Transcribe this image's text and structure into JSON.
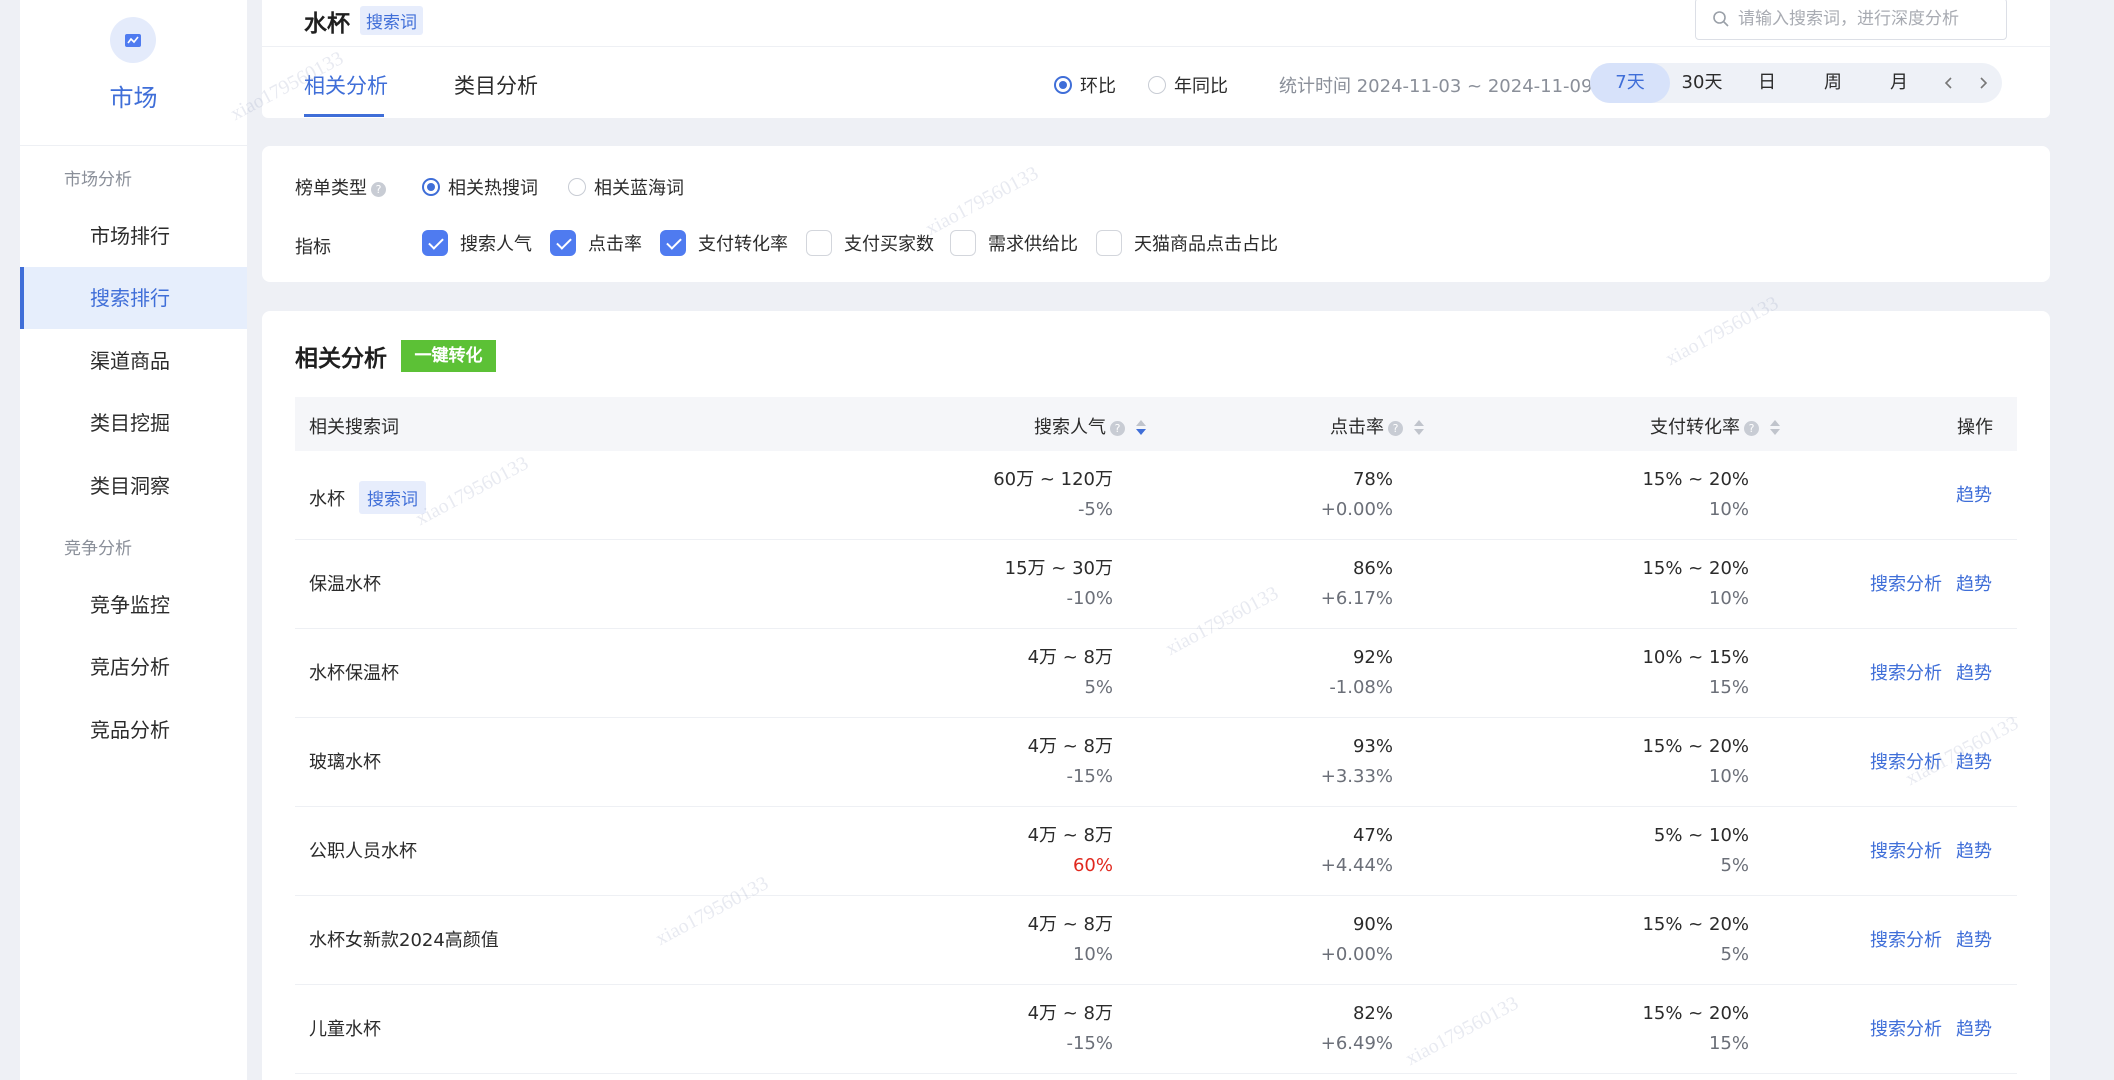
{
  "sidebar": {
    "title": "市场",
    "groups": [
      {
        "label": "市场分析",
        "items": [
          "市场排行",
          "搜索排行",
          "渠道商品",
          "类目挖掘",
          "类目洞察"
        ]
      },
      {
        "label": "竞争分析",
        "items": [
          "竞争监控",
          "竞店分析",
          "竞品分析"
        ]
      }
    ],
    "active": "搜索排行"
  },
  "header": {
    "keyword": "水杯",
    "keyword_tag": "搜索词",
    "search_placeholder": "请输入搜索词，进行深度分析",
    "tabs": [
      "相关分析",
      "类目分析"
    ],
    "active_tab": "相关分析",
    "compare": {
      "options": [
        "环比",
        "年同比"
      ],
      "selected": "环比"
    },
    "stat_time": "统计时间 2024-11-03 ~ 2024-11-09",
    "ranges": [
      "7天",
      "30天",
      "日",
      "周",
      "月"
    ],
    "active_range": "7天"
  },
  "filters": {
    "list_type_label": "榜单类型",
    "list_types": [
      "相关热搜词",
      "相关蓝海词"
    ],
    "list_type_selected": "相关热搜词",
    "metric_label": "指标",
    "metrics": [
      {
        "label": "搜索人气",
        "checked": true
      },
      {
        "label": "点击率",
        "checked": true
      },
      {
        "label": "支付转化率",
        "checked": true
      },
      {
        "label": "支付买家数",
        "checked": false
      },
      {
        "label": "需求供给比",
        "checked": false
      },
      {
        "label": "天猫商品点击占比",
        "checked": false
      }
    ]
  },
  "table": {
    "title": "相关分析",
    "convert_label": "一键转化",
    "columns": [
      "相关搜索词",
      "搜索人气",
      "点击率",
      "支付转化率",
      "操作"
    ],
    "op_search": "搜索分析",
    "op_trend": "趋势",
    "rows": [
      {
        "keyword": "水杯",
        "tag": "搜索词",
        "popularity": "60万 ~ 120万",
        "popularity_change": "-5%",
        "ctr": "78%",
        "ctr_change": "+0.00%",
        "cvr": "15% ~ 20%",
        "cvr_sub": "10%",
        "has_search": false
      },
      {
        "keyword": "保温水杯",
        "tag": "",
        "popularity": "15万 ~ 30万",
        "popularity_change": "-10%",
        "ctr": "86%",
        "ctr_change": "+6.17%",
        "cvr": "15% ~ 20%",
        "cvr_sub": "10%",
        "has_search": true
      },
      {
        "keyword": "水杯保温杯",
        "tag": "",
        "popularity": "4万 ~ 8万",
        "popularity_change": "5%",
        "ctr": "92%",
        "ctr_change": "-1.08%",
        "cvr": "10% ~ 15%",
        "cvr_sub": "15%",
        "has_search": true
      },
      {
        "keyword": "玻璃水杯",
        "tag": "",
        "popularity": "4万 ~ 8万",
        "popularity_change": "-15%",
        "ctr": "93%",
        "ctr_change": "+3.33%",
        "cvr": "15% ~ 20%",
        "cvr_sub": "10%",
        "has_search": true
      },
      {
        "keyword": "公职人员水杯",
        "tag": "",
        "popularity": "4万 ~ 8万",
        "popularity_change": "60%",
        "popularity_change_color": "#e0281e",
        "ctr": "47%",
        "ctr_change": "+4.44%",
        "cvr": "5% ~ 10%",
        "cvr_sub": "5%",
        "has_search": true
      },
      {
        "keyword": "水杯女新款2024高颜值",
        "tag": "",
        "popularity": "4万 ~ 8万",
        "popularity_change": "10%",
        "ctr": "90%",
        "ctr_change": "+0.00%",
        "cvr": "15% ~ 20%",
        "cvr_sub": "5%",
        "has_search": true
      },
      {
        "keyword": "儿童水杯",
        "tag": "",
        "popularity": "4万 ~ 8万",
        "popularity_change": "-15%",
        "ctr": "82%",
        "ctr_change": "+6.49%",
        "cvr": "15% ~ 20%",
        "cvr_sub": "15%",
        "has_search": true
      }
    ]
  },
  "colors": {
    "accent": "#3f6ed8",
    "convert": "#5cc136",
    "negative": "#e0281e"
  },
  "watermark": "xiao179560133"
}
